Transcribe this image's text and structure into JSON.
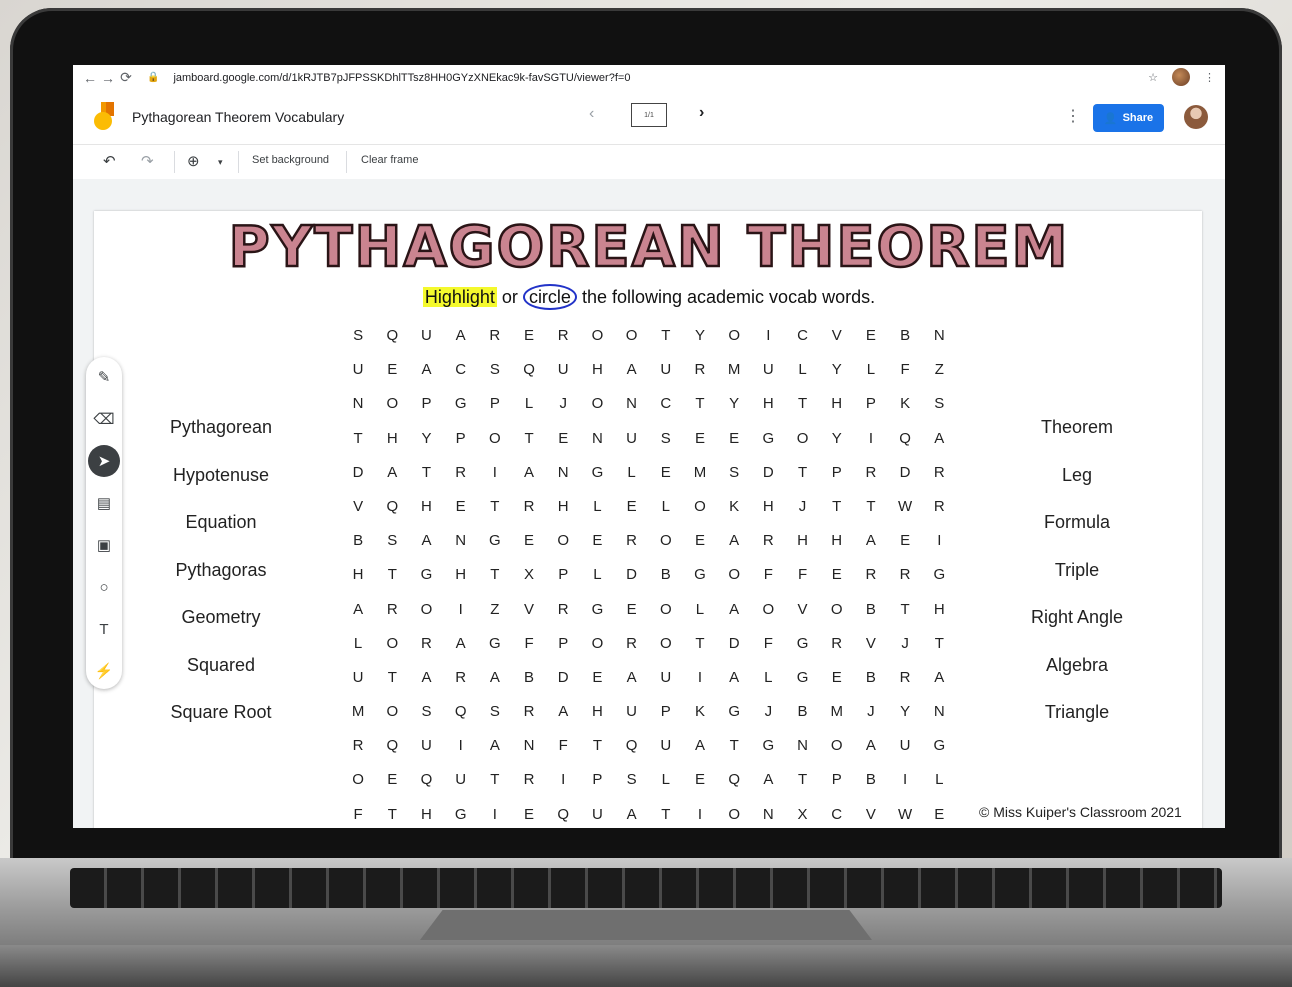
{
  "browser": {
    "url": "jamboard.google.com/d/1kRJTB7pJFPSSKDhlTTsz8HH0GYzXNEkac9k-favSGTU/viewer?f=0",
    "back_icon": "arrow-left-icon",
    "forward_icon": "arrow-right-icon",
    "reload_icon": "reload-icon",
    "star_icon": "star-icon",
    "menu_icon": "kebab-icon"
  },
  "header": {
    "title": "Pythagorean Theorem Vocabulary",
    "frame_indicator": "1/1",
    "share_label": "Share"
  },
  "toolbar": {
    "set_background": "Set background",
    "clear_frame": "Clear frame"
  },
  "sidebar": {
    "tools": [
      "pen-icon",
      "eraser-icon",
      "select-icon",
      "sticky-note-icon",
      "image-icon",
      "circle-icon",
      "text-box-icon",
      "laser-icon"
    ]
  },
  "poster": {
    "title": "PYTHAGOREAN THEOREM",
    "subtitle_highlight": "Highlight",
    "subtitle_or": " or ",
    "subtitle_circle": "circle",
    "subtitle_rest": " the following academic vocab words.",
    "left_words": [
      "Pythagorean",
      "Hypotenuse",
      "Equation",
      "Pythagoras",
      "Geometry",
      "Squared",
      "Square Root"
    ],
    "right_words": [
      "Theorem",
      "Leg",
      "Formula",
      "Triple",
      "Right Angle",
      "Algebra",
      "Triangle"
    ],
    "grid": [
      "SQUAREROOTYOICVEBN",
      "UEACSQUHAURMULYLFZ",
      "NOPGPLJONCTYHTHPKS",
      "THYPOTENUSEEGOYIQA",
      "DATRIANGLEMSDTPRDR",
      "VQHETRHLELOKHJTTWR",
      "BSANGEOEROEARHHAEI",
      "HTGHTXPLDBGOFFERRG",
      "AROIZVRGEOLAOVOBTH",
      "LORAGFPOROTDFGRVJT",
      "UTARABDEAUIALGEBRA",
      "MOSQSRAHUPKGJBMJYN",
      "RQUIANFTQUATGNOAUG",
      "OEQUTRIPSLEQATPBIL",
      "FTHGIEQUATIONXCVWE"
    ],
    "copyright": "© Miss Kuiper's Classroom 2021"
  }
}
